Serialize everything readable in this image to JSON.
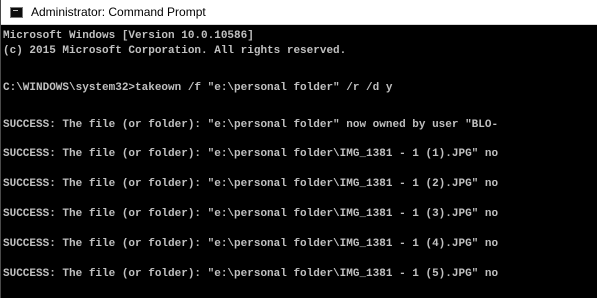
{
  "window": {
    "title": "Administrator: Command Prompt"
  },
  "console": {
    "lines": [
      "Microsoft Windows [Version 10.0.10586]",
      "(c) 2015 Microsoft Corporation. All rights reserved.",
      "C:\\WINDOWS\\system32>takeown /f \"e:\\personal folder\" /r /d y",
      "SUCCESS: The file (or folder): \"e:\\personal folder\" now owned by user \"BLO-",
      "SUCCESS: The file (or folder): \"e:\\personal folder\\IMG_1381 - 1 (1).JPG\" no",
      "SUCCESS: The file (or folder): \"e:\\personal folder\\IMG_1381 - 1 (2).JPG\" no",
      "SUCCESS: The file (or folder): \"e:\\personal folder\\IMG_1381 - 1 (3).JPG\" no",
      "SUCCESS: The file (or folder): \"e:\\personal folder\\IMG_1381 - 1 (4).JPG\" no",
      "SUCCESS: The file (or folder): \"e:\\personal folder\\IMG_1381 - 1 (5).JPG\" no"
    ]
  }
}
